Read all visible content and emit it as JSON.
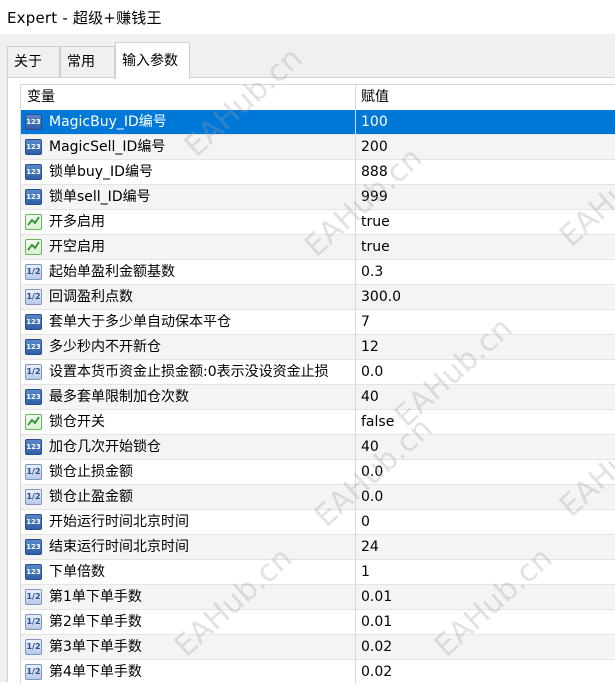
{
  "window": {
    "title": "Expert - 超级+赚钱王"
  },
  "tabs": [
    {
      "label": "关于",
      "active": false
    },
    {
      "label": "常用",
      "active": false
    },
    {
      "label": "输入参数",
      "active": true
    }
  ],
  "grid": {
    "columns": {
      "variable": "变量",
      "value": "赋值"
    },
    "rows": [
      {
        "icon": "int",
        "name": "MagicBuy_ID编号",
        "value": "100",
        "selected": true
      },
      {
        "icon": "int",
        "name": "MagicSell_ID编号",
        "value": "200"
      },
      {
        "icon": "int",
        "name": "锁单buy_ID编号",
        "value": "888"
      },
      {
        "icon": "int",
        "name": "锁单sell_ID编号",
        "value": "999"
      },
      {
        "icon": "bool",
        "name": "开多启用",
        "value": "true"
      },
      {
        "icon": "bool",
        "name": "开空启用",
        "value": "true"
      },
      {
        "icon": "float",
        "name": "起始单盈利金额基数",
        "value": "0.3"
      },
      {
        "icon": "float",
        "name": "回调盈利点数",
        "value": "300.0"
      },
      {
        "icon": "int",
        "name": "套单大于多少单自动保本平仓",
        "value": "7"
      },
      {
        "icon": "int",
        "name": "多少秒内不开新仓",
        "value": "12"
      },
      {
        "icon": "float",
        "name": "设置本货币资金止损金额:0表示没设资金止损",
        "value": "0.0"
      },
      {
        "icon": "int",
        "name": "最多套单限制加仓次数",
        "value": "40"
      },
      {
        "icon": "bool",
        "name": "锁仓开关",
        "value": "false"
      },
      {
        "icon": "int",
        "name": "加仓几次开始锁仓",
        "value": "40"
      },
      {
        "icon": "float",
        "name": "锁仓止损金额",
        "value": "0.0"
      },
      {
        "icon": "float",
        "name": "锁仓止盈金额",
        "value": "0.0"
      },
      {
        "icon": "int",
        "name": "开始运行时间北京时间",
        "value": "0"
      },
      {
        "icon": "int",
        "name": "结束运行时间北京时间",
        "value": "24"
      },
      {
        "icon": "int",
        "name": "下单倍数",
        "value": "1"
      },
      {
        "icon": "float",
        "name": "第1单下单手数",
        "value": "0.01"
      },
      {
        "icon": "float",
        "name": "第2单下单手数",
        "value": "0.01"
      },
      {
        "icon": "float",
        "name": "第3单下单手数",
        "value": "0.02"
      },
      {
        "icon": "float",
        "name": "第4单下单手数",
        "value": "0.02"
      }
    ]
  },
  "icon_labels": {
    "int": "123",
    "float": "1/2"
  },
  "watermark": "EAHub.cn",
  "colors": {
    "selection": "#0078d7",
    "row_alt": "#f4f4f4"
  }
}
